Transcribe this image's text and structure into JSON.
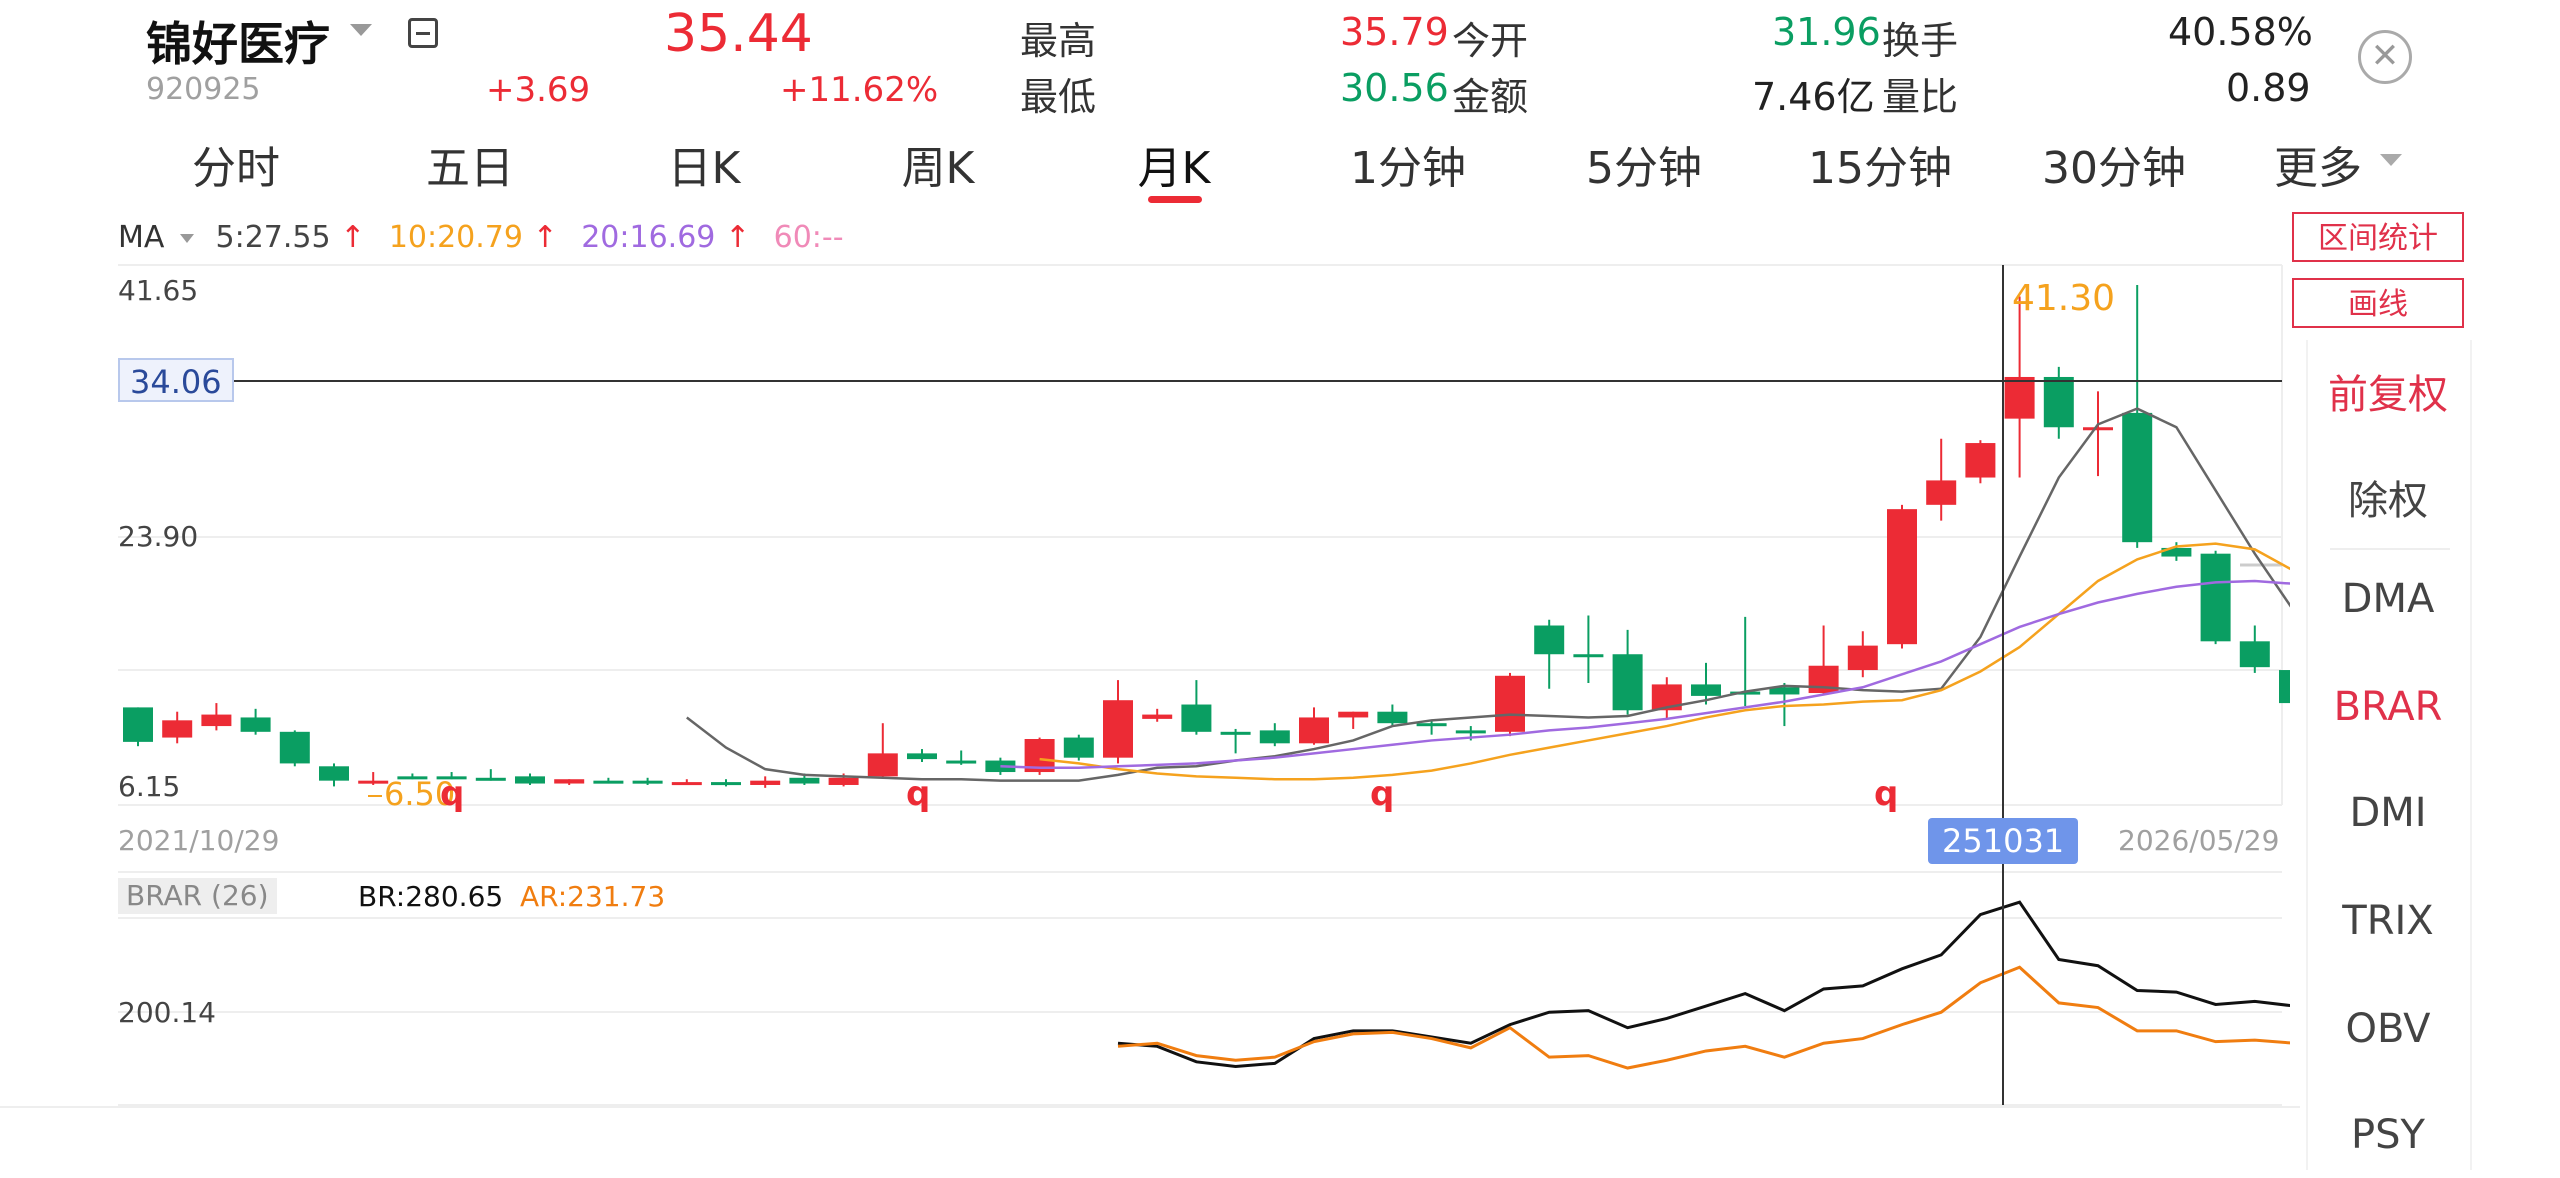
{
  "header": {
    "stock_name": "锦好医疗",
    "stock_code": "920925",
    "price": "35.44",
    "change": "+3.69",
    "change_pct": "+11.62%",
    "high_label": "最高",
    "high_value": "35.79",
    "low_label": "最低",
    "low_value": "30.56",
    "open_label": "今开",
    "open_value": "31.96",
    "amount_label": "金额",
    "amount_value": "7.46亿",
    "turnover_label": "换手",
    "turnover_value": "40.58%",
    "volratio_label": "量比",
    "volratio_value": "0.89"
  },
  "tabs": [
    {
      "label": "分时"
    },
    {
      "label": "五日"
    },
    {
      "label": "日K"
    },
    {
      "label": "周K"
    },
    {
      "label": "月K",
      "active": true
    },
    {
      "label": "1分钟"
    },
    {
      "label": "5分钟"
    },
    {
      "label": "15分钟"
    },
    {
      "label": "30分钟"
    },
    {
      "label": "更多"
    }
  ],
  "ma_legend": {
    "label": "MA",
    "ma5": "5:27.55",
    "ma10": "10:20.79",
    "ma20": "20:16.69",
    "ma60": "60:--",
    "arrow": "↑"
  },
  "price_axis": {
    "top": "41.65",
    "mid": "23.90",
    "bottom": "6.15",
    "crosshair": "34.06"
  },
  "annotations": {
    "high_mark": "41.30",
    "low_mark": "6.50",
    "q_marker": "q"
  },
  "time_axis": {
    "start": "2021/10/29",
    "cursor": "251031",
    "end": "2026/05/29"
  },
  "indicator": {
    "name": "BRAR (26)",
    "br": "BR:280.65",
    "ar": "AR:231.73",
    "level": "200.14"
  },
  "side_buttons": {
    "range_stats": "区间统计",
    "draw": "画线"
  },
  "side_menu": [
    {
      "label": "前复权",
      "highlight": true
    },
    {
      "label": "除权"
    },
    {
      "label": "DMA"
    },
    {
      "label": "BRAR",
      "highlight": true
    },
    {
      "label": "DMI"
    },
    {
      "label": "TRIX"
    },
    {
      "label": "OBV"
    },
    {
      "label": "PSY"
    }
  ],
  "colors": {
    "up": "#ec2b35",
    "down": "#0a9e62",
    "ma5": "#666666",
    "ma10": "#f5a21e",
    "ma20": "#a06ae0",
    "br": "#111111",
    "ar": "#f07d10"
  },
  "chart_data": {
    "type": "candlestick",
    "period": "monthly",
    "ylim": [
      6.15,
      41.65
    ],
    "candles": [
      {
        "o": 9.5,
        "h": 10.9,
        "c": 11.9,
        "l": 9.2,
        "up": false
      },
      {
        "o": 9.8,
        "h": 11.6,
        "c": 11.0,
        "l": 9.4,
        "up": true
      },
      {
        "o": 10.6,
        "h": 12.2,
        "c": 11.4,
        "l": 10.3,
        "up": true
      },
      {
        "o": 11.2,
        "h": 11.8,
        "c": 10.2,
        "l": 10.0,
        "up": false
      },
      {
        "o": 10.2,
        "h": 10.3,
        "c": 8.0,
        "l": 7.8,
        "up": false
      },
      {
        "o": 7.8,
        "h": 8.0,
        "c": 6.8,
        "l": 6.4,
        "up": false
      },
      {
        "o": 6.8,
        "h": 7.4,
        "c": 6.8,
        "l": 6.5,
        "up": true
      },
      {
        "o": 7.1,
        "h": 7.3,
        "c": 7.0,
        "l": 6.9,
        "up": false
      },
      {
        "o": 7.1,
        "h": 7.4,
        "c": 7.0,
        "l": 6.9,
        "up": false
      },
      {
        "o": 7.0,
        "h": 7.6,
        "c": 7.0,
        "l": 6.8,
        "up": false
      },
      {
        "o": 7.1,
        "h": 7.3,
        "c": 6.6,
        "l": 6.5,
        "up": false
      },
      {
        "o": 6.6,
        "h": 6.9,
        "c": 6.9,
        "l": 6.5,
        "up": true
      },
      {
        "o": 6.8,
        "h": 7.0,
        "c": 6.8,
        "l": 6.6,
        "up": false
      },
      {
        "o": 6.8,
        "h": 7.0,
        "c": 6.6,
        "l": 6.5,
        "up": false
      },
      {
        "o": 6.6,
        "h": 6.9,
        "c": 6.7,
        "l": 6.5,
        "up": true
      },
      {
        "o": 6.7,
        "h": 6.9,
        "c": 6.6,
        "l": 6.4,
        "up": false
      },
      {
        "o": 6.5,
        "h": 7.1,
        "c": 6.8,
        "l": 6.3,
        "up": true
      },
      {
        "o": 6.6,
        "h": 7.3,
        "c": 7.0,
        "l": 6.5,
        "up": false
      },
      {
        "o": 6.5,
        "h": 7.3,
        "c": 7.0,
        "l": 6.4,
        "up": true
      },
      {
        "o": 7.1,
        "h": 10.8,
        "c": 8.7,
        "l": 7.0,
        "up": true
      },
      {
        "o": 8.7,
        "h": 9.0,
        "c": 8.3,
        "l": 8.1,
        "up": false
      },
      {
        "o": 8.2,
        "h": 8.9,
        "c": 8.0,
        "l": 7.9,
        "up": false
      },
      {
        "o": 8.2,
        "h": 8.4,
        "c": 7.4,
        "l": 7.2,
        "up": false
      },
      {
        "o": 7.4,
        "h": 9.8,
        "c": 9.7,
        "l": 7.2,
        "up": true
      },
      {
        "o": 9.8,
        "h": 10.0,
        "c": 8.4,
        "l": 8.2,
        "up": false
      },
      {
        "o": 8.4,
        "h": 13.8,
        "c": 12.4,
        "l": 8.0,
        "up": true
      },
      {
        "o": 11.1,
        "h": 11.8,
        "c": 11.4,
        "l": 10.9,
        "up": true
      },
      {
        "o": 12.1,
        "h": 13.8,
        "c": 10.2,
        "l": 10.0,
        "up": false
      },
      {
        "o": 10.2,
        "h": 10.4,
        "c": 10.0,
        "l": 8.7,
        "up": false
      },
      {
        "o": 10.3,
        "h": 10.8,
        "c": 9.4,
        "l": 9.2,
        "up": false
      },
      {
        "o": 9.4,
        "h": 11.9,
        "c": 11.2,
        "l": 9.3,
        "up": true
      },
      {
        "o": 11.2,
        "h": 11.6,
        "c": 11.6,
        "l": 10.4,
        "up": true
      },
      {
        "o": 11.6,
        "h": 12.1,
        "c": 10.8,
        "l": 10.6,
        "up": false
      },
      {
        "o": 10.8,
        "h": 11.0,
        "c": 10.7,
        "l": 10.0,
        "up": false
      },
      {
        "o": 10.3,
        "h": 10.6,
        "c": 10.1,
        "l": 9.6,
        "up": false
      },
      {
        "o": 10.2,
        "h": 14.3,
        "c": 14.1,
        "l": 9.9,
        "up": true
      },
      {
        "o": 17.6,
        "h": 18.0,
        "c": 15.6,
        "l": 13.2,
        "up": false
      },
      {
        "o": 15.5,
        "h": 18.3,
        "c": 15.6,
        "l": 13.6,
        "up": false
      },
      {
        "o": 15.6,
        "h": 17.3,
        "c": 11.7,
        "l": 11.4,
        "up": false
      },
      {
        "o": 11.7,
        "h": 14.0,
        "c": 13.5,
        "l": 11.1,
        "up": true
      },
      {
        "o": 12.7,
        "h": 15.0,
        "c": 13.5,
        "l": 12.1,
        "up": false
      },
      {
        "o": 13.0,
        "h": 18.2,
        "c": 12.9,
        "l": 12.0,
        "up": false
      },
      {
        "o": 12.8,
        "h": 13.6,
        "c": 13.3,
        "l": 10.6,
        "up": false
      },
      {
        "o": 12.9,
        "h": 17.6,
        "c": 14.8,
        "l": 12.8,
        "up": true
      },
      {
        "o": 14.5,
        "h": 17.2,
        "c": 16.2,
        "l": 14.0,
        "up": true
      },
      {
        "o": 16.3,
        "h": 26.0,
        "c": 25.7,
        "l": 16.0,
        "up": true
      },
      {
        "o": 26.0,
        "h": 30.6,
        "c": 27.7,
        "l": 24.9,
        "up": true
      },
      {
        "o": 27.9,
        "h": 30.5,
        "c": 30.3,
        "l": 27.5,
        "up": true
      },
      {
        "o": 32.0,
        "h": 40.5,
        "c": 34.9,
        "l": 27.9,
        "up": true
      },
      {
        "o": 34.9,
        "h": 35.6,
        "c": 31.4,
        "l": 30.6,
        "up": false
      },
      {
        "o": 31.4,
        "h": 33.9,
        "c": 31.3,
        "l": 28.0,
        "up": true
      },
      {
        "o": 32.4,
        "h": 41.3,
        "c": 23.4,
        "l": 23.0,
        "up": false
      },
      {
        "o": 23.0,
        "h": 23.4,
        "c": 22.4,
        "l": 22.1,
        "up": false
      },
      {
        "o": 22.6,
        "h": 22.8,
        "c": 16.5,
        "l": 16.3,
        "up": false
      },
      {
        "o": 16.5,
        "h": 17.6,
        "c": 14.7,
        "l": 14.3,
        "up": false
      },
      {
        "o": 14.5,
        "h": 15.0,
        "c": 12.2,
        "l": 11.8,
        "up": false
      }
    ],
    "ma5": [
      11.2,
      9.1,
      7.6,
      7.2,
      7.1,
      7.0,
      6.9,
      6.9,
      6.8,
      6.8,
      6.8,
      7.2,
      7.7,
      7.8,
      8.2,
      8.5,
      9.0,
      9.6,
      10.6,
      11.0,
      11.2,
      11.4,
      11.3,
      11.2,
      11.3,
      11.9,
      12.4,
      13.0,
      13.4,
      13.3,
      13.1,
      13.0,
      13.2,
      16.8,
      22.4,
      27.9,
      31.6,
      32.7,
      31.4,
      27.0,
      22.6,
      18.6
    ],
    "ma10": [
      8.3,
      8.0,
      7.6,
      7.3,
      7.1,
      7.0,
      6.9,
      6.9,
      7.0,
      7.2,
      7.5,
      8.0,
      8.6,
      9.1,
      9.6,
      10.1,
      10.6,
      11.2,
      11.7,
      12.0,
      12.1,
      12.3,
      12.4,
      13.1,
      14.4,
      16.1,
      18.4,
      20.7,
      22.2,
      23.1,
      23.3,
      22.9,
      21.4
    ],
    "ma20": [
      7.8,
      7.7,
      7.7,
      7.8,
      7.9,
      8.0,
      8.2,
      8.4,
      8.7,
      9.0,
      9.3,
      9.6,
      9.8,
      10.0,
      10.3,
      10.5,
      10.8,
      11.1,
      11.5,
      11.9,
      12.3,
      12.8,
      13.3,
      14.2,
      15.1,
      16.3,
      17.5,
      18.4,
      19.2,
      19.8,
      20.3,
      20.6,
      20.7,
      20.5
    ],
    "br": [
      180,
      178,
      168,
      165,
      167,
      183,
      188,
      188,
      184,
      180,
      192,
      200,
      201,
      190,
      196,
      204,
      212,
      201,
      215,
      217,
      228,
      237,
      263,
      271,
      234,
      230,
      214,
      213,
      205,
      207,
      204
    ],
    "ar": [
      178,
      180,
      172,
      169,
      171,
      181,
      186,
      187,
      183,
      177,
      190,
      171,
      172,
      164,
      169,
      175,
      178,
      171,
      180,
      183,
      192,
      200,
      219,
      229,
      206,
      203,
      188,
      188,
      181,
      182,
      180
    ]
  }
}
